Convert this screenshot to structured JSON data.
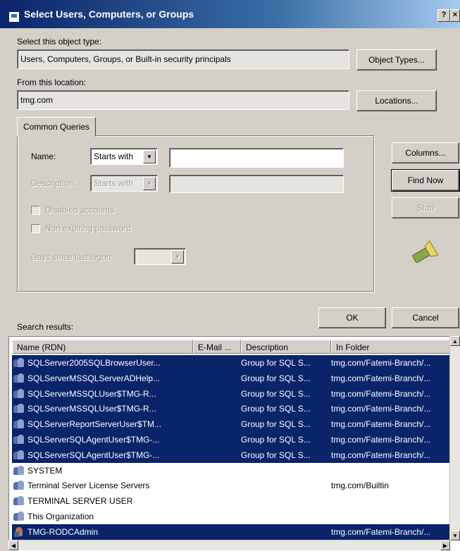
{
  "window": {
    "title": "Select Users, Computers, or Groups",
    "help_btn": "?",
    "close_btn": "×"
  },
  "object_type": {
    "label": "Select this object type:",
    "value": "Users, Computers, Groups, or Built-in security principals",
    "button": "Object Types..."
  },
  "location": {
    "label": "From this location:",
    "value": "tmg.com",
    "button": "Locations..."
  },
  "common_queries": {
    "tab": "Common Queries",
    "name_label": "Name:",
    "name_mode": "Starts with",
    "name_value": "",
    "desc_label": "Description:",
    "desc_mode": "Starts with",
    "disabled_accounts": "Disabled accounts",
    "non_expiring": "Non expiring password",
    "days_label": "Days since last logon:"
  },
  "side_buttons": {
    "columns": "Columns...",
    "find_now": "Find Now",
    "stop": "Stop"
  },
  "actions": {
    "ok": "OK",
    "cancel": "Cancel"
  },
  "results": {
    "label": "Search results:",
    "columns": [
      "Name (RDN)",
      "E-Mail ...",
      "Description",
      "In Folder"
    ],
    "rows": [
      {
        "icon": "group-icon",
        "name": "SQLServer2005SQLBrowserUser...",
        "email": "",
        "desc": "Group for SQL S...",
        "folder": "tmg.com/Fatemi-Branch/...",
        "selected": true
      },
      {
        "icon": "group-icon",
        "name": "SQLServerMSSQLServerADHelp...",
        "email": "",
        "desc": "Group for SQL S...",
        "folder": "tmg.com/Fatemi-Branch/...",
        "selected": true
      },
      {
        "icon": "group-icon",
        "name": "SQLServerMSSQLUser$TMG-R...",
        "email": "",
        "desc": "Group for SQL S...",
        "folder": "tmg.com/Fatemi-Branch/...",
        "selected": true
      },
      {
        "icon": "group-icon",
        "name": "SQLServerMSSQLUser$TMG-R...",
        "email": "",
        "desc": "Group for SQL S...",
        "folder": "tmg.com/Fatemi-Branch/...",
        "selected": true
      },
      {
        "icon": "group-icon",
        "name": "SQLServerReportServerUser$TM...",
        "email": "",
        "desc": "Group for SQL S...",
        "folder": "tmg.com/Fatemi-Branch/...",
        "selected": true
      },
      {
        "icon": "group-icon",
        "name": "SQLServerSQLAgentUser$TMG-...",
        "email": "",
        "desc": "Group for SQL S...",
        "folder": "tmg.com/Fatemi-Branch/...",
        "selected": true
      },
      {
        "icon": "group-icon",
        "name": "SQLServerSQLAgentUser$TMG-...",
        "email": "",
        "desc": "Group for SQL S...",
        "folder": "tmg.com/Fatemi-Branch/...",
        "selected": true
      },
      {
        "icon": "group-icon",
        "name": "SYSTEM",
        "email": "",
        "desc": "",
        "folder": "",
        "selected": false
      },
      {
        "icon": "group-icon",
        "name": "Terminal Server License Servers",
        "email": "",
        "desc": "",
        "folder": "tmg.com/Builtin",
        "selected": false
      },
      {
        "icon": "group-icon",
        "name": "TERMINAL SERVER USER",
        "email": "",
        "desc": "",
        "folder": "",
        "selected": false
      },
      {
        "icon": "group-icon",
        "name": "This Organization",
        "email": "",
        "desc": "",
        "folder": "",
        "selected": false
      },
      {
        "icon": "user-icon",
        "name": "TMG-RODCAdmin",
        "email": "",
        "desc": "",
        "folder": "tmg.com/Fatemi-Branch/...",
        "selected": true
      }
    ]
  }
}
